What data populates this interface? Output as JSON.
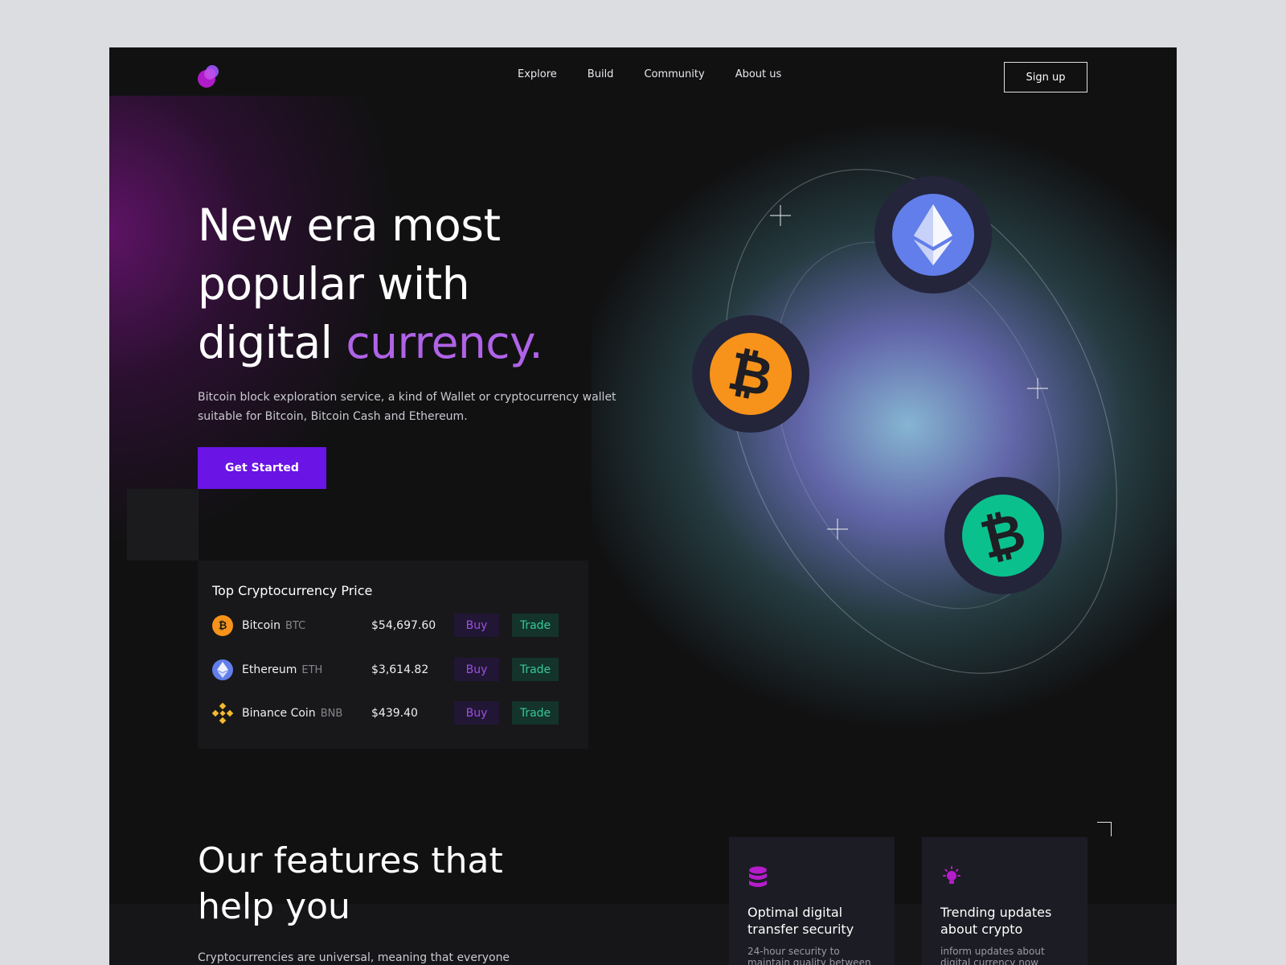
{
  "nav": {
    "items": [
      "Explore",
      "Build",
      "Community",
      "About us"
    ],
    "signup_label": "Sign up"
  },
  "hero": {
    "headline_line1": "New era most",
    "headline_line2": "popular with",
    "headline_line3_plain": "digital",
    "headline_line3_accent": "currency.",
    "subtitle": "Bitcoin block exploration service, a kind of Wallet or cryptocurrency wallet suitable for Bitcoin, Bitcoin Cash and Ethereum.",
    "cta_label": "Get Started"
  },
  "prices": {
    "title": "Top Cryptocurrency Price",
    "rows": [
      {
        "name": "Bitcoin",
        "symbol": "BTC",
        "price": "$54,697.60",
        "buy": "Buy",
        "trade": "Trade",
        "icon": "bitcoin-icon",
        "color": "#f7931a"
      },
      {
        "name": "Ethereum",
        "symbol": "ETH",
        "price": "$3,614.82",
        "buy": "Buy",
        "trade": "Trade",
        "icon": "ethereum-icon",
        "color": "#627eea"
      },
      {
        "name": "Binance Coin",
        "symbol": "BNB",
        "price": "$439.40",
        "buy": "Buy",
        "trade": "Trade",
        "icon": "binance-icon",
        "color": "#f3ba2f"
      }
    ]
  },
  "graphic": {
    "coins": [
      "ethereum-icon",
      "bitcoin-icon",
      "bitcoin-cash-icon"
    ],
    "colors": {
      "ethereum": "#627eea",
      "bitcoin": "#f7931a",
      "bitcoin_cash": "#0ac18e"
    }
  },
  "features": {
    "title_line1": "Our features that",
    "title_line2": "help you",
    "text": "Cryptocurrencies are universal, meaning that everyone",
    "cards": [
      {
        "title": "Optimal digital transfer security",
        "desc": "24-hour security to maintain quality between",
        "icon": "database-icon"
      },
      {
        "title": "Trending updates about crypto",
        "desc": "inform updates about digital currency now",
        "icon": "lightbulb-icon"
      }
    ]
  },
  "colors": {
    "accent": "#6a14e6",
    "accent_text": "#b063e8",
    "background": "#111112"
  }
}
